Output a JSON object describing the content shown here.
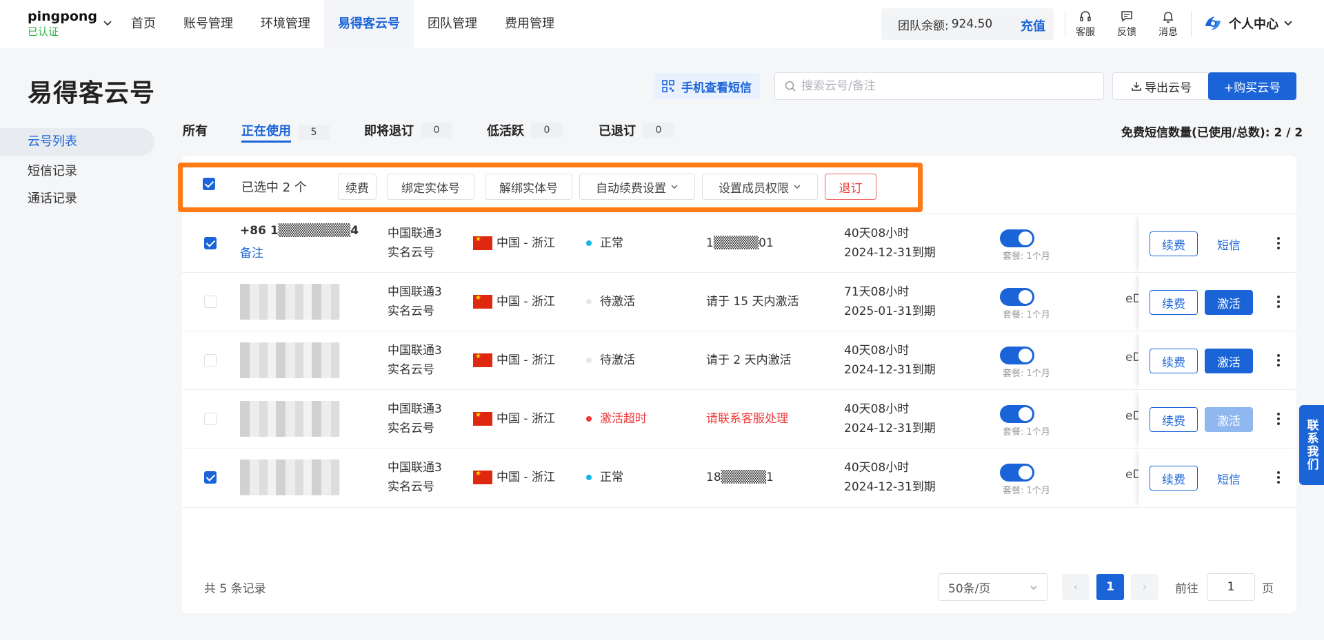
{
  "brand": {
    "name": "pingpong",
    "status": "已认证"
  },
  "nav": {
    "tabs": [
      "首页",
      "账号管理",
      "环境管理",
      "易得客云号",
      "团队管理",
      "费用管理"
    ]
  },
  "balance": {
    "label": "团队余额:",
    "amount": "924.50",
    "recharge": "充值"
  },
  "tools": {
    "service": "客服",
    "feedback": "反馈",
    "messages": "消息"
  },
  "user_center": "个人中心",
  "page": {
    "title": "易得客云号"
  },
  "actions": {
    "qr_sms": "手机查看短信",
    "search_placeholder": "搜索云号/备注",
    "export": "导出云号",
    "buy": "+购买云号"
  },
  "side_menu": [
    "云号列表",
    "短信记录",
    "通话记录"
  ],
  "status_tabs": [
    {
      "label": "所有"
    },
    {
      "label": "正在使用",
      "count": "5"
    },
    {
      "label": "即将退订",
      "count": "0"
    },
    {
      "label": "低活跃",
      "count": "0"
    },
    {
      "label": "已退订",
      "count": "0"
    }
  ],
  "sms_quota": "免费短信数量(已使用/总数): 2 / 2",
  "toolbar": {
    "selected_text": "已选中 2 个",
    "buttons": [
      "续费",
      "绑定实体号",
      "解绑实体号",
      "自动续费设置",
      "设置成员权限",
      "退订"
    ]
  },
  "rows": [
    {
      "checked": true,
      "phone": "+86 1▒▒▒▒▒▒▒▒4",
      "remark": "备注",
      "carrier": "中国联通3",
      "type": "实名云号",
      "region": "中国 - 浙江",
      "status": "正常",
      "status_color": "#19b5e8",
      "info": "1▒▒▒▒▒01",
      "days": "40天08小时",
      "expire": "2024-12-31到期",
      "plan": "套餐: 1个月",
      "code": "",
      "renew": "续费",
      "action": "短信",
      "action_style": "link"
    },
    {
      "checked": false,
      "phone": "",
      "remark": "",
      "carrier": "中国联通3",
      "type": "实名云号",
      "region": "中国 - 浙江",
      "status": "待激活",
      "status_color": "#e4e6ea",
      "info": "请于 15 天内激活",
      "days": "71天08小时",
      "expire": "2025-01-31到期",
      "plan": "套餐: 1个月",
      "code": "eD",
      "renew": "续费",
      "action": "激活",
      "action_style": "primary"
    },
    {
      "checked": false,
      "phone": "",
      "remark": "",
      "carrier": "中国联通3",
      "type": "实名云号",
      "region": "中国 - 浙江",
      "status": "待激活",
      "status_color": "#e4e6ea",
      "info": "请于 2 天内激活",
      "days": "40天08小时",
      "expire": "2024-12-31到期",
      "plan": "套餐: 1个月",
      "code": "eD",
      "renew": "续费",
      "action": "激活",
      "action_style": "primary"
    },
    {
      "checked": false,
      "phone": "",
      "remark": "",
      "carrier": "中国联通3",
      "type": "实名云号",
      "region": "中国 - 浙江",
      "status": "激活超时",
      "status_color": "#ef3b3b",
      "info": "请联系客服处理",
      "days": "40天08小时",
      "expire": "2024-12-31到期",
      "plan": "套餐: 1个月",
      "code": "eD",
      "renew": "续费",
      "action": "激活",
      "action_style": "disabled"
    },
    {
      "checked": true,
      "phone": "",
      "remark": "",
      "carrier": "中国联通3",
      "type": "实名云号",
      "region": "中国 - 浙江",
      "status": "正常",
      "status_color": "#19b5e8",
      "info": "18▒▒▒▒▒1",
      "days": "40天08小时",
      "expire": "2024-12-31到期",
      "plan": "套餐: 1个月",
      "code": "eD",
      "renew": "续费",
      "action": "短信",
      "action_style": "link"
    }
  ],
  "pagination": {
    "total": "共 5 条记录",
    "page_size": "50条/页",
    "current": "1",
    "goto_label": "前往",
    "goto_value": "1",
    "goto_unit": "页"
  },
  "contact": "联系我们",
  "colors": {
    "primary": "#1b64d8",
    "highlight": "#ff7a14",
    "danger": "#ef3b3b",
    "verified": "#35b34a"
  }
}
